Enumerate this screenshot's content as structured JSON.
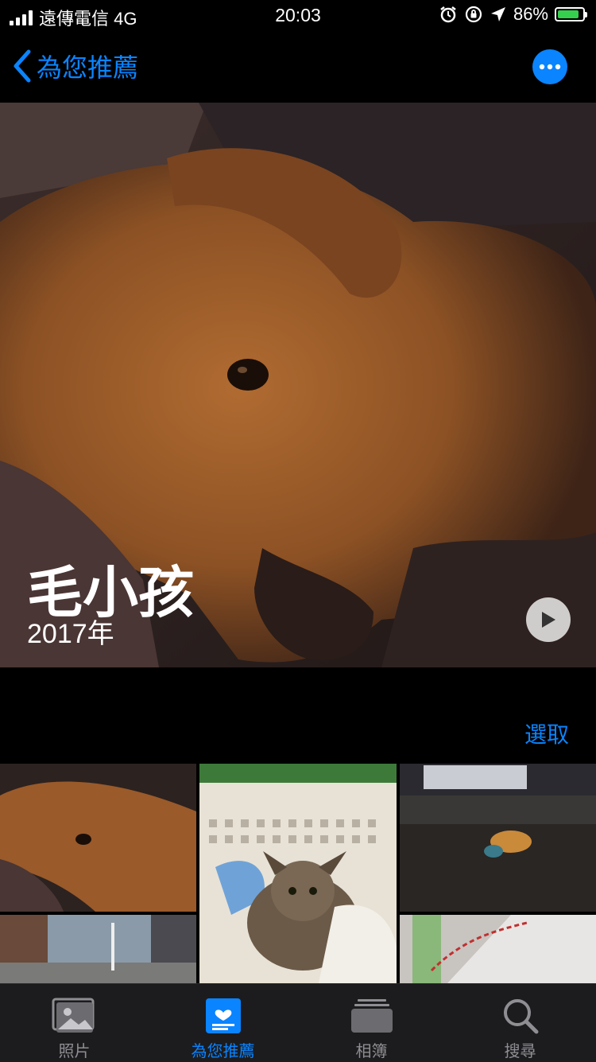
{
  "status_bar": {
    "carrier": "遠傳電信 4G",
    "time": "20:03",
    "battery_percent": "86%",
    "battery_level": 0.86,
    "icons": [
      "signal-icon",
      "alarm-icon",
      "orientation-lock-icon",
      "location-icon",
      "battery-charging-icon"
    ]
  },
  "nav": {
    "back_title": "為您推薦",
    "more_icon": "ellipsis-icon"
  },
  "hero": {
    "title": "毛小孩",
    "subtitle": "2017年",
    "play_icon": "play-icon"
  },
  "actions": {
    "select_label": "選取"
  },
  "tabs": [
    {
      "label": "照片",
      "icon": "photos-icon",
      "active": false
    },
    {
      "label": "為您推薦",
      "icon": "for-you-icon",
      "active": true
    },
    {
      "label": "相簿",
      "icon": "albums-icon",
      "active": false
    },
    {
      "label": "搜尋",
      "icon": "search-icon",
      "active": false
    }
  ],
  "colors": {
    "accent": "#0a84ff",
    "background": "#000000",
    "tabbar": "#1c1c1e",
    "inactive": "#8e8e93",
    "battery_fill": "#35d04d"
  }
}
